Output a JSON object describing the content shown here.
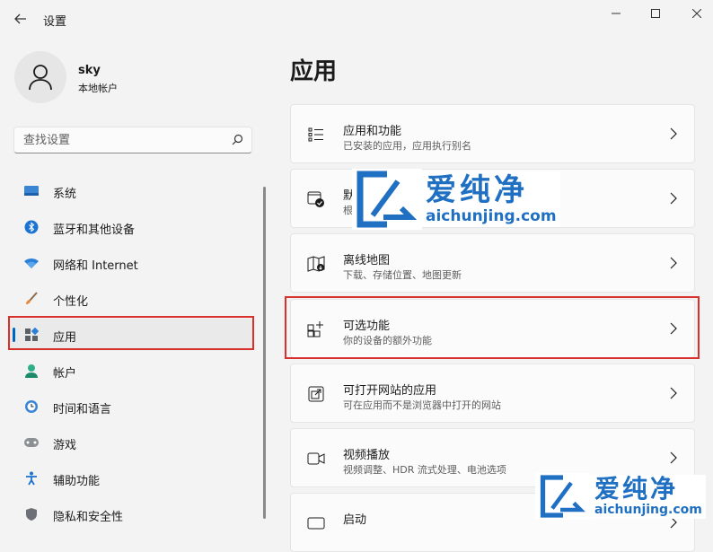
{
  "window": {
    "title": "设置"
  },
  "user": {
    "name": "sky",
    "account_type": "本地帐户"
  },
  "search": {
    "placeholder": "查找设置"
  },
  "nav": [
    {
      "label": "系统",
      "icon": "system-icon"
    },
    {
      "label": "蓝牙和其他设备",
      "icon": "bluetooth-icon"
    },
    {
      "label": "网络和 Internet",
      "icon": "wifi-icon"
    },
    {
      "label": "个性化",
      "icon": "brush-icon"
    },
    {
      "label": "应用",
      "icon": "apps-icon",
      "selected": true
    },
    {
      "label": "帐户",
      "icon": "account-icon"
    },
    {
      "label": "时间和语言",
      "icon": "clock-globe-icon"
    },
    {
      "label": "游戏",
      "icon": "gamepad-icon"
    },
    {
      "label": "辅助功能",
      "icon": "accessibility-icon"
    },
    {
      "label": "隐私和安全性",
      "icon": "shield-icon"
    }
  ],
  "main": {
    "title": "应用",
    "cards": [
      {
        "title": "应用和功能",
        "subtitle": "已安装的应用，应用执行别名",
        "icon": "list-icon"
      },
      {
        "title": "默认应用",
        "subtitle": "根据文件和链接类型选择默认应用，其他默认应用",
        "icon": "default-apps-icon"
      },
      {
        "title": "离线地图",
        "subtitle": "下载、存储位置、地图更新",
        "icon": "map-icon"
      },
      {
        "title": "可选功能",
        "subtitle": "你的设备的额外功能",
        "icon": "optional-features-icon",
        "highlighted": true
      },
      {
        "title": "可打开网站的应用",
        "subtitle": "可在应用而不是浏览器中打开的网站",
        "icon": "open-web-icon"
      },
      {
        "title": "视频播放",
        "subtitle": "视频调整、HDR 流式处理、电池选项",
        "icon": "video-icon"
      },
      {
        "title": "启动",
        "subtitle": "",
        "icon": "startup-icon"
      }
    ]
  },
  "watermark": {
    "title": "爱纯净",
    "url": "aichunjing.com"
  },
  "colors": {
    "accent": "#0067c0",
    "highlight": "#d9302c",
    "watermark": "#1f6fc2"
  }
}
